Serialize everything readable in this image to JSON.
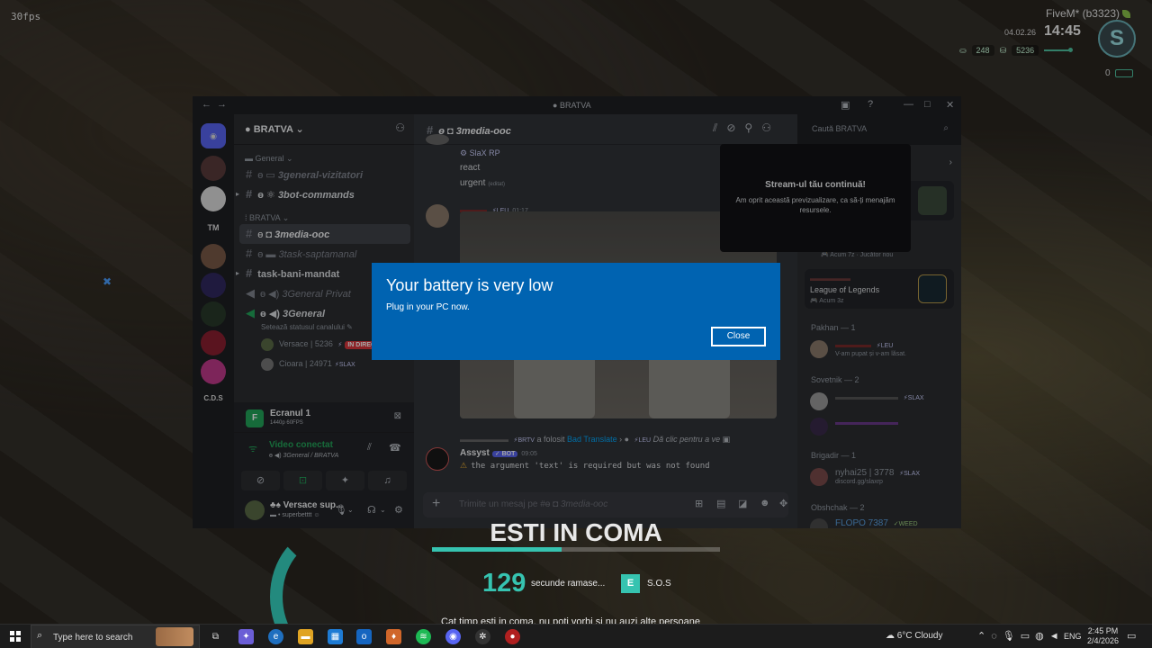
{
  "hud": {
    "fps": "30fps",
    "server": "FiveM* (b3323)",
    "date": "04.02.26",
    "time": "14:45",
    "stat1": "248",
    "stat2": "5236",
    "zero": "0"
  },
  "discord": {
    "window_title": "BRATVA",
    "server_name": "BRATVA",
    "server_initials_tm": "TM",
    "server_initials_cds": "C.D.S",
    "categories": {
      "general": "General",
      "bratva": "BRATVA"
    },
    "channels": {
      "general_vizitatori": "3general-vizitatori",
      "bot_commands": "3bot-commands",
      "media_ooc": "3media-ooc",
      "task_saptamanal": "3task-saptamanal",
      "task_bani_mandat": "task-bani-mandat",
      "general_privat": "3General Privat",
      "general_voice": "3General",
      "general_voice_status": "Setează statusul canalului"
    },
    "voice_users": [
      {
        "name": "Versace | 5236",
        "badge": "IN DIRECT"
      },
      {
        "name": "Cioara | 24971",
        "badge": "SLAX"
      }
    ],
    "stream": {
      "title": "Ecranul 1",
      "sub": "1440p 60FPS"
    },
    "voice": {
      "status": "Video conectat",
      "location": "3General / BRATVA"
    },
    "user": {
      "name": "Versace sup...",
      "status": "superbetttt"
    },
    "chat": {
      "channel": "3media-ooc",
      "top_name": "SlaX RP",
      "msg1": "react",
      "msg2": "urgent",
      "edited": "(editat)",
      "media_author_tag": "LEU",
      "media_time": "01:17",
      "reply_tag": "BRTV",
      "reply_text": "a folosit",
      "reply_link": "Bad Translate",
      "reply_leu": "LEU",
      "reply_hint": "Dă clic pentru a ve",
      "bot_name": "Assyst",
      "bot_tag": "BOT",
      "bot_time": "09:05",
      "bot_msg": "the argument 'text' is required but was not found",
      "placeholder": "Trimite un mesaj pe #"
    },
    "search_placeholder": "Caută BRATVA",
    "stream_paused": {
      "title": "Stream-ul tău continuă!",
      "desc": "Am oprit această previzualizare, ca să-ți menajăm resursele."
    },
    "members": {
      "card1_when": "Acum 7z",
      "card1_status": "Jucător nou",
      "card2_game": "League of Legends",
      "card2_when": "Acum 3z",
      "group_pakhan": "Pakhan — 1",
      "pakhan_tag": "LEU",
      "pakhan_sub": "V-am pupat și v-am lăsat.",
      "group_sovetnik": "Sovetnik — 2",
      "sov1_tag": "SLAX",
      "group_brigadir": "Brigadir — 1",
      "brig_name": "nyhai25 | 3778",
      "brig_tag": "SLAX",
      "brig_sub": "discord.gg/slaxrp",
      "group_obshchak": "Obshchak — 2",
      "obs_name": "FLOPO 7387",
      "obs_tag": "WEED"
    }
  },
  "toast": {
    "title": "Your battery is very low",
    "message": "Plug in your PC now.",
    "close_label": "Close"
  },
  "coma": {
    "title": "ESTI IN COMA",
    "count": "129",
    "seconds_label": "secunde ramase...",
    "key": "E",
    "sos": "S.O.S",
    "hint": "Cat timp esti in coma, nu poti vorbi si nu auzi alte persoane",
    "progress": 0.45
  },
  "taskbar": {
    "search_placeholder": "Type here to search",
    "weather": "6°C  Cloudy",
    "lang": "ENG",
    "time": "2:45 PM",
    "date": "2/4/2026"
  }
}
